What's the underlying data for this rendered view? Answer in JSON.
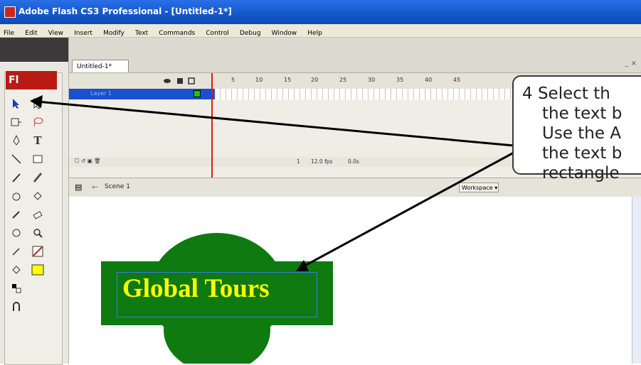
{
  "window": {
    "title": "Adobe Flash CS3 Professional - [Untitled-1*]"
  },
  "menubar": {
    "items": [
      "File",
      "Edit",
      "View",
      "Insert",
      "Modify",
      "Text",
      "Commands",
      "Control",
      "Debug",
      "Window",
      "Help"
    ]
  },
  "toolbox": {
    "badge": "Fl"
  },
  "document": {
    "tab_label": "Untitled-1*",
    "window_controls": "_ ×"
  },
  "timeline": {
    "frame_numbers": [
      "5",
      "10",
      "15",
      "20",
      "25",
      "30",
      "35",
      "40",
      "45"
    ],
    "layer_name": "Layer 1",
    "status": {
      "frame": "1",
      "fps": "12.0 fps",
      "time": "0.0s"
    }
  },
  "scene": {
    "label": "Scene 1",
    "workspace": "Workspace ▾"
  },
  "stage": {
    "logo_text": "Global Tours",
    "colors": {
      "shape": "#0e7a10",
      "text": "#ffff00",
      "selection": "#3b7bf0"
    }
  },
  "callout": {
    "lines": [
      "4  Select th",
      "the text b",
      "Use the A",
      "the text b",
      "rectangle"
    ]
  },
  "icons": [
    "selection-tool-icon",
    "subselection-tool-icon",
    "free-transform-icon",
    "lasso-icon",
    "pen-tool-icon",
    "text-tool-icon",
    "line-tool-icon",
    "rectangle-tool-icon",
    "pencil-icon",
    "brush-icon",
    "ink-bottle-icon",
    "paint-bucket-icon",
    "eyedropper-icon",
    "eraser-icon",
    "hand-icon",
    "zoom-icon",
    "stroke-color-icon",
    "fill-color-icon",
    "swap-colors-icon",
    "snap-magnet-icon"
  ]
}
